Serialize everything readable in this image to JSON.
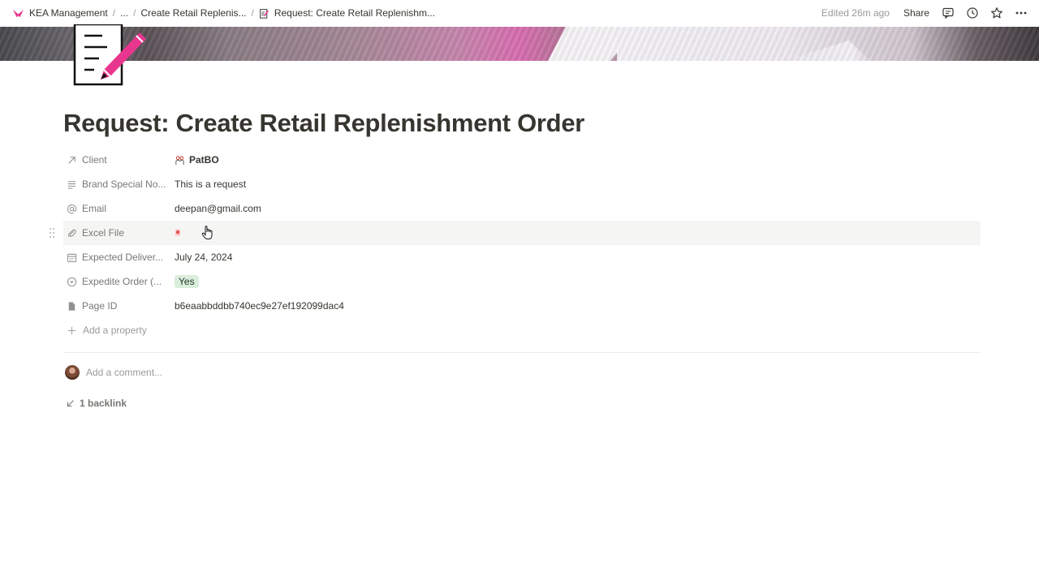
{
  "breadcrumbs": {
    "workspace": "KEA Management",
    "ellipsis": "...",
    "parent": "Create Retail Replenis...",
    "current": "Request: Create Retail Replenishm...",
    "separator": "/"
  },
  "topbar": {
    "edited": "Edited 26m ago",
    "share": "Share"
  },
  "page": {
    "title": "Request: Create Retail Replenishment Order"
  },
  "properties": {
    "client": {
      "label": "Client",
      "value": "PatBO"
    },
    "brand_notes": {
      "label": "Brand Special No...",
      "value": "This is a request"
    },
    "email": {
      "label": "Email",
      "value": "deepan@gmail.com"
    },
    "excel_file": {
      "label": "Excel File"
    },
    "expected_delivery": {
      "label": "Expected Deliver...",
      "value": "July 24, 2024"
    },
    "expedite": {
      "label": "Expedite Order (...",
      "value": "Yes"
    },
    "page_id": {
      "label": "Page ID",
      "value": "b6eaabbddbb740ec9e27ef192099dac4"
    },
    "add_property": "Add a property"
  },
  "comment": {
    "placeholder": "Add a comment..."
  },
  "backlinks": {
    "label": "1 backlink"
  },
  "colors": {
    "accent": "#e8368f",
    "tag_green": "#dbeddb",
    "text": "#37352f",
    "muted": "#787774"
  }
}
